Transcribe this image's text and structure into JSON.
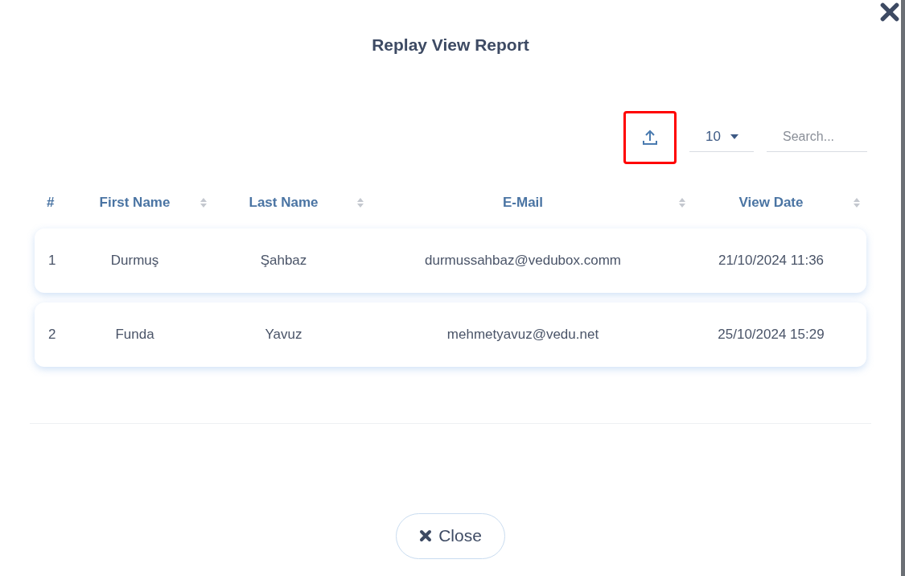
{
  "modal": {
    "title": "Replay View Report"
  },
  "toolbar": {
    "export_highlighted": true,
    "page_size": "10",
    "search": {
      "placeholder": "Search..."
    }
  },
  "table": {
    "columns": [
      {
        "label": "#",
        "sortable": false
      },
      {
        "label": "First Name",
        "sortable": true
      },
      {
        "label": "Last Name",
        "sortable": true
      },
      {
        "label": "E-Mail",
        "sortable": true
      },
      {
        "label": "View Date",
        "sortable": true
      }
    ],
    "rows": [
      [
        "1",
        "Durmuş",
        "Şahbaz",
        "durmussahbaz@vedubox.comm",
        "21/10/2024 11:36"
      ],
      [
        "2",
        "Funda",
        "Yavuz",
        "mehmetyavuz@vedu.net",
        "25/10/2024 15:29"
      ]
    ]
  },
  "footer": {
    "close_label": "Close"
  }
}
